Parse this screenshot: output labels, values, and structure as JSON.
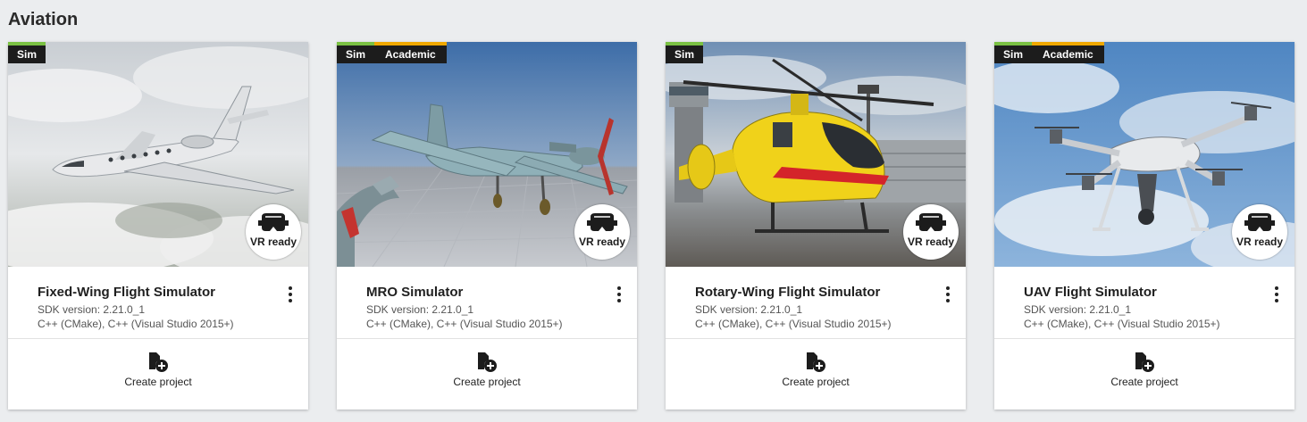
{
  "section": {
    "title": "Aviation"
  },
  "cards": [
    {
      "badges": [
        "Sim"
      ],
      "vr_label": "VR ready",
      "title": "Fixed-Wing Flight Simulator",
      "sdk": "SDK version: 2.21.0_1",
      "languages": "C++ (CMake), C++ (Visual Studio 2015+)",
      "action_label": "Create project"
    },
    {
      "badges": [
        "Sim",
        "Academic"
      ],
      "vr_label": "VR ready",
      "title": "MRO Simulator",
      "sdk": "SDK version: 2.21.0_1",
      "languages": "C++ (CMake), C++ (Visual Studio 2015+)",
      "action_label": "Create project"
    },
    {
      "badges": [
        "Sim"
      ],
      "vr_label": "VR ready",
      "title": "Rotary-Wing Flight Simulator",
      "sdk": "SDK version: 2.21.0_1",
      "languages": "C++ (CMake), C++ (Visual Studio 2015+)",
      "action_label": "Create project"
    },
    {
      "badges": [
        "Sim",
        "Academic"
      ],
      "vr_label": "VR ready",
      "title": "UAV Flight Simulator",
      "sdk": "SDK version: 2.21.0_1",
      "languages": "C++ (CMake), C++ (Visual Studio 2015+)",
      "action_label": "Create project"
    }
  ],
  "icons": {
    "more": "more-vertical-icon",
    "create": "new-file-plus-icon",
    "vr": "vr-headset-icon"
  },
  "colors": {
    "sim_accent": "#7ac143",
    "academic_accent": "#f0a800",
    "badge_bg": "#1c1c1c"
  }
}
